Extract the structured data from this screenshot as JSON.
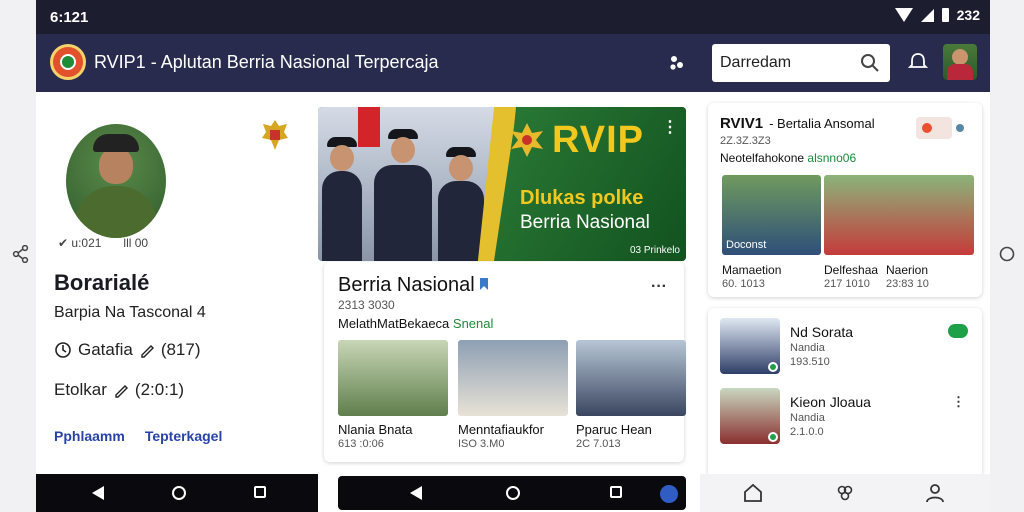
{
  "status": {
    "time": "6:121",
    "right_text": "232"
  },
  "header": {
    "title": "RVIP1 - Aplutan Berria Nasional Terpercaja",
    "search_value": "Darredam"
  },
  "profile": {
    "meta_left": "✔ u:021",
    "meta_right": "lll 00",
    "name": "Borarialé",
    "subtitle": "Barpia Na Tasconal 4",
    "stat1_label": "Gatafia",
    "stat1_value": "(817)",
    "stat2_label": "Etolkar",
    "stat2_value": "(2:0:1)",
    "links": [
      "Pphlaamm",
      "Tepterkagel"
    ]
  },
  "hero": {
    "brand": "RVIP",
    "line1": "Dlukas polke",
    "line2": "Berria Nasional",
    "small": "03 Prinkelo"
  },
  "center_card": {
    "title": "Berria Nasional",
    "date": "2313 3030",
    "subline_prefix": "MelathMatBekaeca",
    "subline_tag": "Snenal",
    "thumbs": [
      {
        "caption": "Nlania Bnata",
        "sub": "613 :0:06"
      },
      {
        "caption": "Menntafiaukfor",
        "sub": "ISO 3.M0"
      },
      {
        "caption": "Pparuc Hean",
        "sub": "2C 7.013"
      }
    ]
  },
  "right_card": {
    "title": "RVIV1",
    "title_rest": "- Bertalia Ansomal",
    "date": "2Z.3Z.3Z3",
    "subline_prefix": "Neotelfahokone",
    "subline_tag": "alsnno06",
    "overlay": "Doconst",
    "items": [
      {
        "label": "Mamaetion",
        "sub": "60. 1013"
      },
      {
        "label": "Delfeshaa",
        "sub": "217 1010"
      },
      {
        "label": "Naerion",
        "sub": "23:83 10"
      }
    ]
  },
  "right_list": [
    {
      "name": "Nd Sorata",
      "label": "Nandia",
      "value": "193.510"
    },
    {
      "name": "Kieon Jloaua",
      "label": "Nandia",
      "value": "2.1.0.0"
    }
  ]
}
